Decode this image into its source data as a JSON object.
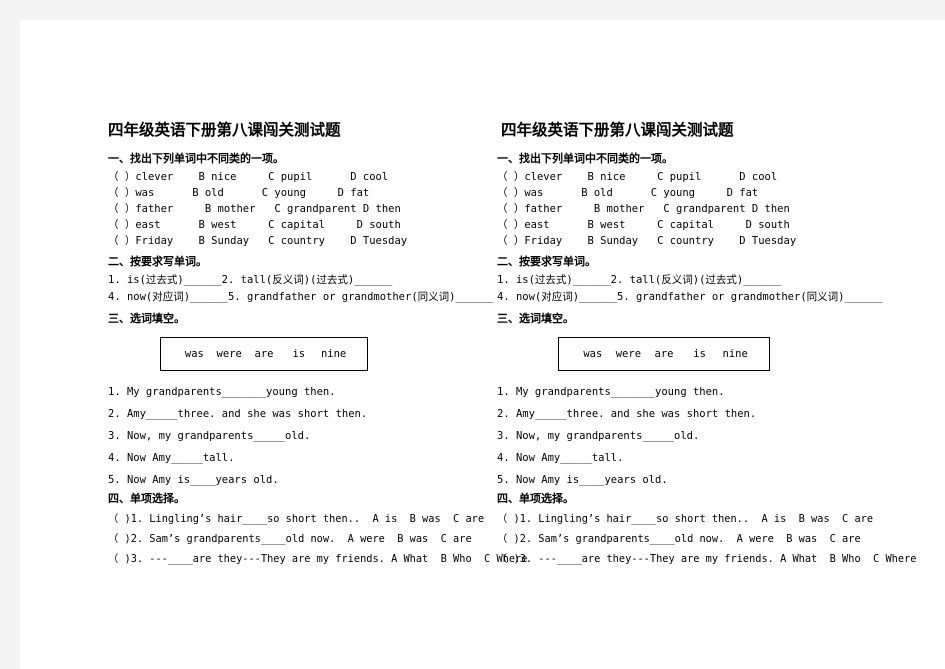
{
  "document": {
    "title": "四年级英语下册第八课闯关测试题",
    "sections": [
      {
        "heading": "一、找出下列单词中不同类的一项。",
        "type": "odd-one-out",
        "items": [
          "（ ）clever    B nice     C pupil      D cool",
          "（ ）was      B old      C young     D fat",
          "（ ）father     B mother   C grandparent D then",
          "（ ）east      B west     C capital     D south",
          "（ ）Friday    B Sunday   C country    D Tuesday"
        ]
      },
      {
        "heading": "二、按要求写单词。",
        "type": "word-forms",
        "items": [
          "1. is(过去式)______2. tall(反义词)(过去式)______",
          "4. now(对应词)______5. grandfather or grandmother(同义词)______"
        ]
      },
      {
        "heading": "三、选词填空。",
        "type": "word-bank-fill",
        "word_bank": [
          "was",
          "were",
          "are",
          "is",
          "nine"
        ],
        "items": [
          "1. My grandparents_______young then.",
          "2. Amy_____three. and she was short then.",
          "3. Now, my grandparents_____old.",
          "4. Now Amy_____tall.",
          "5. Now Amy is____years old."
        ]
      },
      {
        "heading": "四、单项选择。",
        "type": "multiple-choice",
        "items": [
          "（ )1. Lingling’s hair____so short then..  A is  B was  C are",
          "（ )2. Sam’s grandparents____old now.  A were  B was  C are",
          "（ )3. ---____are they---They are my friends. A What  B Who  C Where"
        ]
      }
    ]
  },
  "colors": {
    "page_background": "#ffffff",
    "canvas_background": "#f4f4f4",
    "text": "#000000",
    "border": "#000000"
  }
}
